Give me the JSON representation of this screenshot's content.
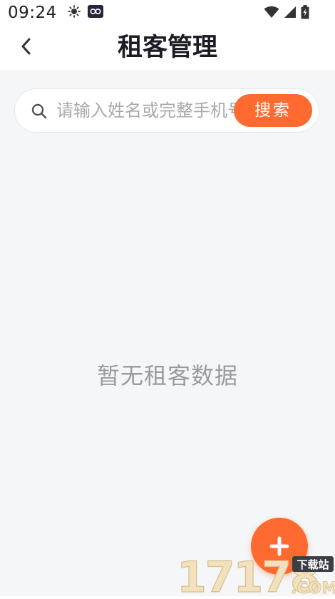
{
  "status_bar": {
    "time": "09:24"
  },
  "nav": {
    "title": "租客管理"
  },
  "search": {
    "placeholder": "请输入姓名或完整手机号",
    "button_label": "搜索"
  },
  "empty_state": {
    "text": "暂无租客数据"
  },
  "colors": {
    "accent": "#fe6a2f",
    "background": "#f5f6f8",
    "placeholder": "#a9aaae",
    "empty_text": "#9a9b9e"
  },
  "icons": {
    "back": "chevron-left-icon",
    "search": "search-icon",
    "add": "plus-icon"
  },
  "watermark": {
    "number": "17178",
    "domain": ".COM",
    "tag": "下载站"
  }
}
